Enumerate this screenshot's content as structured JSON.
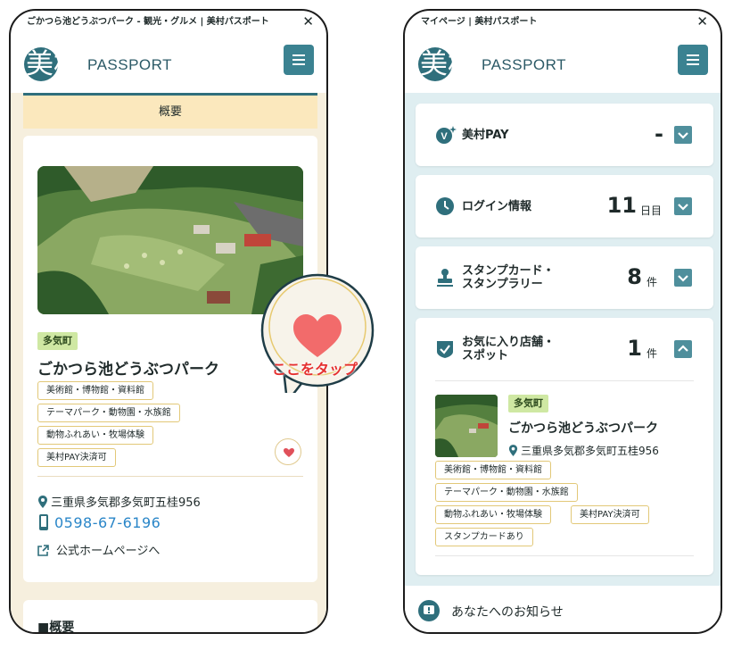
{
  "left": {
    "window_title": "ごかつら池どうぶつパーク - 観光・グルメ | 美村パスポート",
    "logo": {
      "kanji": "美村",
      "text": "PASSPORT"
    },
    "tab_label": "概要",
    "spot": {
      "town": "多気町",
      "name": "ごかつら池どうぶつパーク",
      "tags": [
        "美術館・博物館・資料館",
        "テーマパーク・動物園・水族館",
        "動物ふれあい・牧場体験",
        "美村PAY決済可"
      ],
      "address": "三重県多気郡多気町五桂956",
      "phone": "0598-67-6196",
      "homepage": "公式ホームページへ"
    },
    "section_title": "■概要",
    "callout": "ここをタップ"
  },
  "right": {
    "window_title": "マイページ | 美村パスポート",
    "logo": {
      "kanji": "美村",
      "text": "PASSPORT"
    },
    "rows": [
      {
        "label": "美村PAY",
        "value": "-",
        "unit": ""
      },
      {
        "label": "ログイン情報",
        "value": "11",
        "unit": "日目"
      },
      {
        "label": "スタンプカード・\nスタンプラリー",
        "value": "8",
        "unit": "件"
      },
      {
        "label": "お気に入り店舗・\nスポット",
        "value": "1",
        "unit": "件"
      }
    ],
    "favorite": {
      "town": "多気町",
      "name": "ごかつら池どうぶつパーク",
      "address": "三重県多気郡多気町五桂956",
      "tags": [
        "美術館・博物館・資料館",
        "テーマパーク・動物園・水族館",
        "動物ふれあい・牧場体験",
        "美村PAY決済可",
        "スタンプカードあり"
      ]
    },
    "notice": "あなたへのお知らせ"
  },
  "colors": {
    "accent": "#3b8291",
    "tab_bg": "#fbe8bd",
    "page_bg_left": "#f6efde",
    "page_bg_right": "#dfeef1",
    "heart": "#f26b6b",
    "callout": "#e53030",
    "link": "#2a86c8"
  },
  "icons": [
    "close-icon",
    "menu-icon",
    "heart-icon",
    "location-pin-icon",
    "phone-icon",
    "external-link-icon",
    "pay-icon",
    "clock-icon",
    "stamp-icon",
    "check-shield-icon",
    "chevron-down-icon",
    "chevron-up-icon",
    "notice-icon"
  ]
}
